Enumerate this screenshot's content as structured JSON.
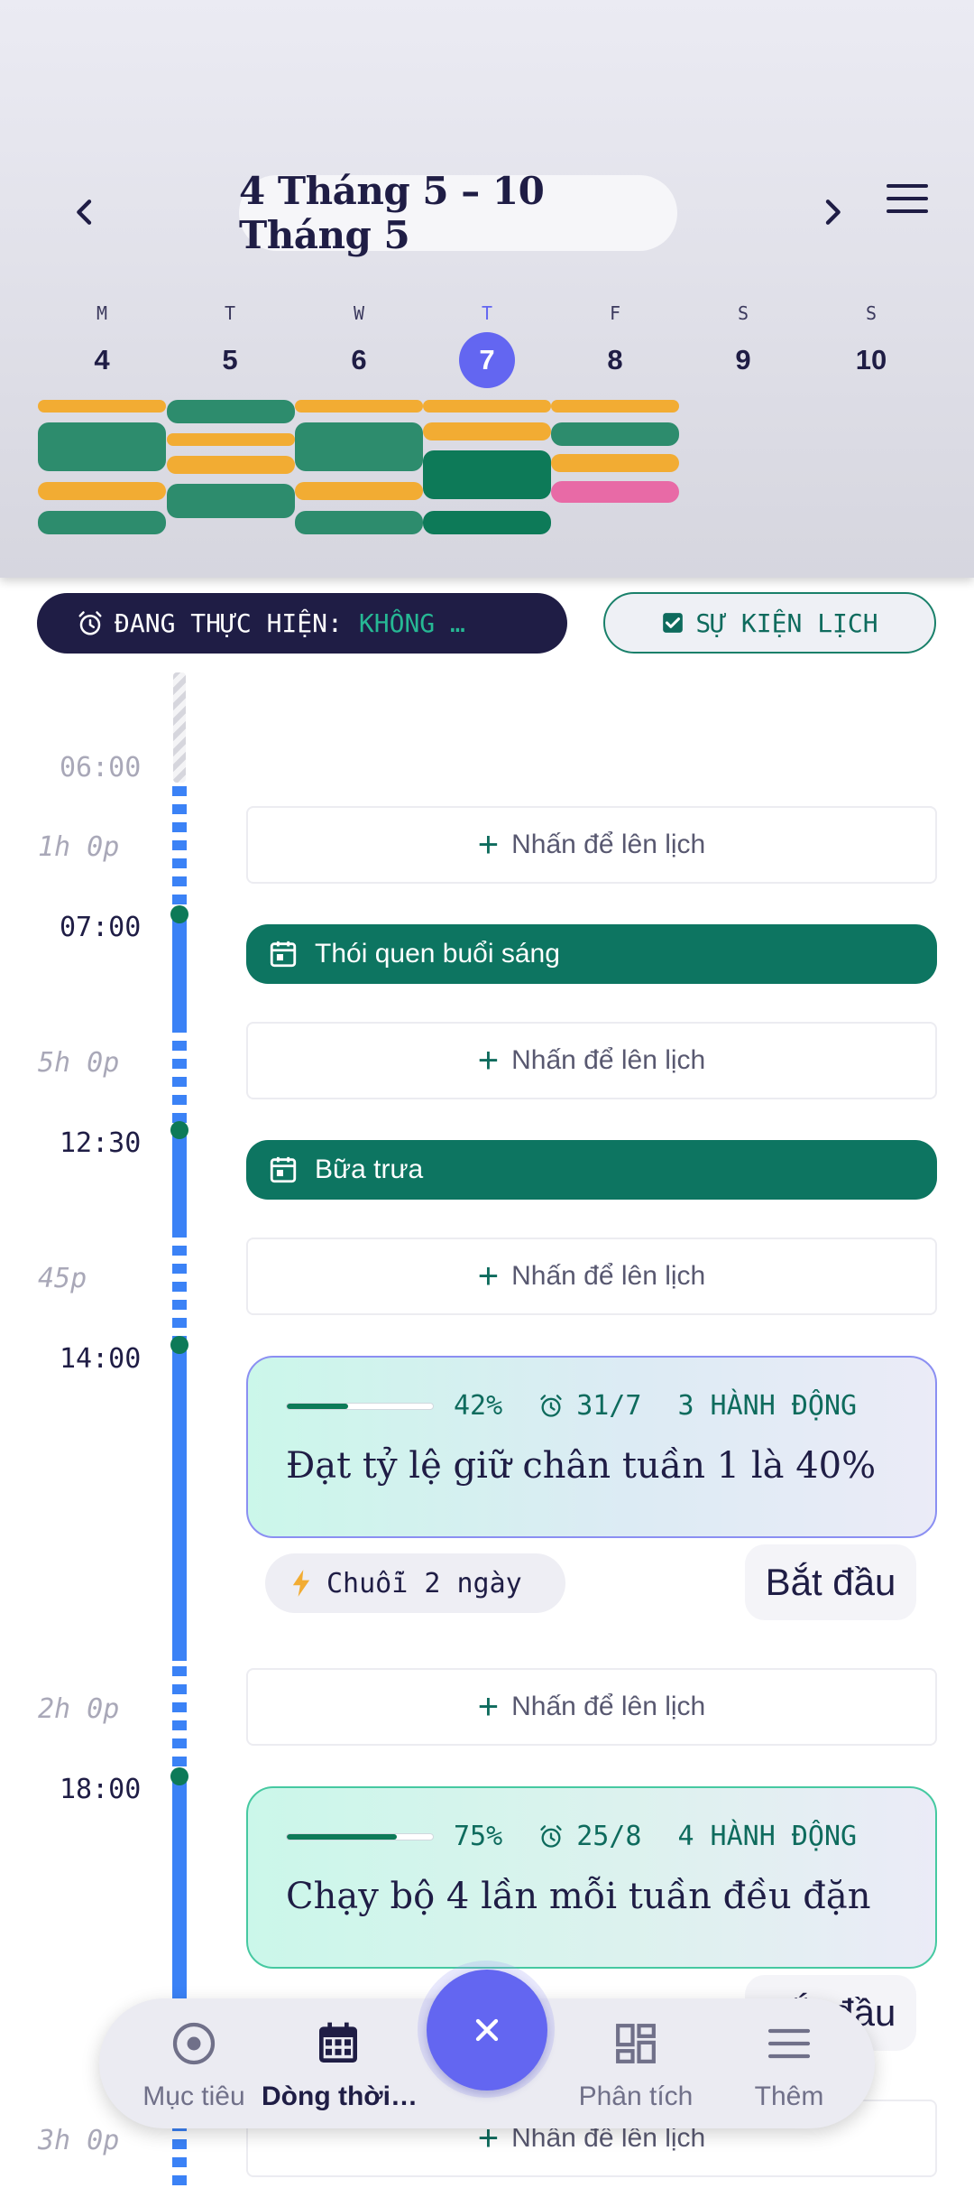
{
  "header": {
    "date_range": "4 Tháng 5 – 10 Tháng 5",
    "days": [
      {
        "letter": "M",
        "num": "4"
      },
      {
        "letter": "T",
        "num": "5"
      },
      {
        "letter": "W",
        "num": "6"
      },
      {
        "letter": "T",
        "num": "7",
        "today": true
      },
      {
        "letter": "F",
        "num": "8"
      },
      {
        "letter": "S",
        "num": "9"
      },
      {
        "letter": "S",
        "num": "10"
      }
    ]
  },
  "status": {
    "now_label": "ĐANG THỰC HIỆN:",
    "now_value": "KHÔNG …",
    "calendar_events": "SỰ KIỆN LỊCH"
  },
  "timeline": {
    "times": {
      "t0600": "06:00",
      "t0700": "07:00",
      "t1230": "12:30",
      "t1400": "14:00",
      "t1800": "18:00"
    },
    "gaps": {
      "g1": "1h 0p",
      "g2": "5h 0p",
      "g3": "45p",
      "g4": "2h 0p",
      "g5": "3h 0p"
    },
    "slot_label": "Nhấn để lên lịch",
    "events": {
      "e1": "Thói quen buổi sáng",
      "e2": "Bữa trưa"
    },
    "goals": [
      {
        "progress": 42,
        "percent": "42%",
        "deadline": "31/7",
        "actions": "3 HÀNH ĐỘNG",
        "title": "Đạt tỷ lệ giữ chân tuần 1 là 40%",
        "streak": "Chuỗi 2 ngày",
        "start": "Bắt đầu"
      },
      {
        "progress": 75,
        "percent": "75%",
        "deadline": "25/8",
        "actions": "4 HÀNH ĐỘNG",
        "title": "Chạy bộ 4 lần mỗi tuần đều đặn",
        "start": "Bắt đầu"
      }
    ]
  },
  "bottom_nav": {
    "goals": "Mục tiêu",
    "timeline": "Dòng thời…",
    "analytics": "Phân tích",
    "more": "Thêm"
  },
  "colors": {
    "accent": "#6366f1",
    "primary_green": "#0d7561",
    "event_orange": "#f2ac33",
    "event_pink": "#e86aa6",
    "timeline_blue": "#3b82f6"
  }
}
